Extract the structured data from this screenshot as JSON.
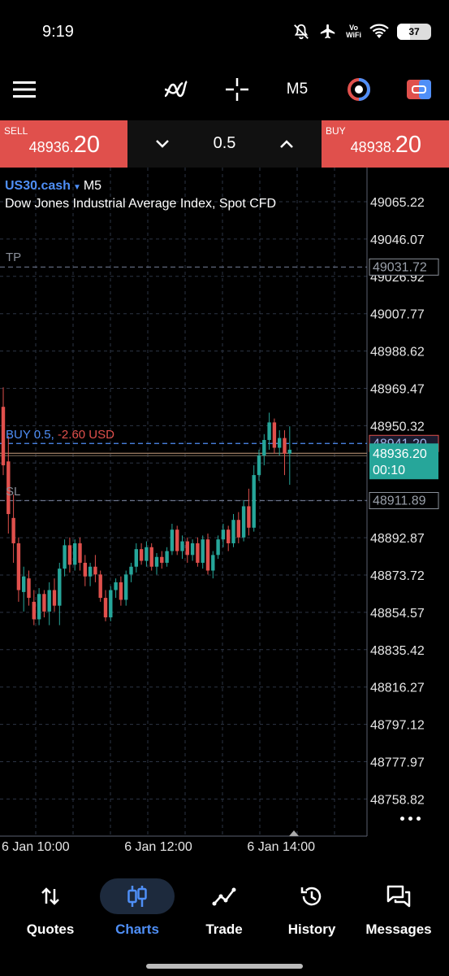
{
  "status_bar": {
    "time": "9:19",
    "network_label": "Vo\nWiFi",
    "battery": "37",
    "battery_level": 0.37
  },
  "toolbar": {
    "menu_icon": "hamburger-menu-icon",
    "indicators_icon": "indicators-icon",
    "crosshair_icon": "crosshair-icon",
    "timeframe": "M5",
    "chart_mode_icon": "chart-mode-icon",
    "trade_toggle_icon": "one-click-trade-icon"
  },
  "trade_panel": {
    "sell": {
      "label": "SELL",
      "price_main": "48936.",
      "price_big": "20"
    },
    "buy": {
      "label": "BUY",
      "price_main": "48938.",
      "price_big": "20"
    },
    "volume": "0.5"
  },
  "chart_header": {
    "symbol": "US30.cash",
    "timeframe": "M5",
    "description": "Dow Jones Industrial Average Index, Spot CFD"
  },
  "levels": {
    "tp_label": "TP",
    "tp_price": "49031.72",
    "sl_label": "SL",
    "sl_price": "48911.89",
    "position_side": "BUY 0.5,",
    "position_pl": "-2.60 USD",
    "position_price": "48941.20",
    "bid_price": "48936.20",
    "countdown": "00:10"
  },
  "colors": {
    "up": "#26a69a",
    "down": "#e0504c",
    "accent": "#4f8ff7",
    "grid": "#2c3444",
    "tp_sl_line": "#6a7289"
  },
  "chart_data": {
    "type": "candlestick",
    "symbol": "US30.cash",
    "timeframe": "M5",
    "y_ticks": [
      49065.22,
      49046.07,
      49026.92,
      49007.77,
      48988.62,
      48969.47,
      48950.32,
      48931.17,
      48912.02,
      48892.87,
      48873.72,
      48854.57,
      48835.42,
      48816.27,
      48797.12,
      48777.97,
      48758.82
    ],
    "y_tick_labels": [
      "49065.22",
      "49046.07",
      "49026.92",
      "49007.77",
      "48988.62",
      "48969.47",
      "48950.32",
      "",
      "",
      "48892.87",
      "48873.72",
      "48854.57",
      "48835.42",
      "48816.27",
      "48797.12",
      "48777.97",
      "48758.82"
    ],
    "ylim": [
      48752,
      49075
    ],
    "x_labels": [
      "6 Jan 10:00",
      "6 Jan 12:00",
      "6 Jan 14:00"
    ],
    "x_label_candle_index": [
      0,
      24,
      48
    ],
    "grid": true,
    "candles": [
      [
        48960,
        48970,
        48925,
        48930
      ],
      [
        48932,
        48945,
        48895,
        48905
      ],
      [
        48903,
        48915,
        48880,
        48890
      ],
      [
        48890,
        48893,
        48860,
        48866
      ],
      [
        48865,
        48878,
        48855,
        48873
      ],
      [
        48872,
        48876,
        48858,
        48862
      ],
      [
        48860,
        48866,
        48848,
        48851
      ],
      [
        48851,
        48867,
        48848,
        48864
      ],
      [
        48864,
        48866,
        48852,
        48855
      ],
      [
        48855,
        48870,
        48848,
        48866
      ],
      [
        48866,
        48872,
        48855,
        48858
      ],
      [
        48858,
        48880,
        48848,
        48877
      ],
      [
        48877,
        48892,
        48873,
        48889
      ],
      [
        48889,
        48893,
        48875,
        48879
      ],
      [
        48879,
        48892,
        48876,
        48890
      ],
      [
        48890,
        48893,
        48876,
        48880
      ],
      [
        48880,
        48884,
        48868,
        48873
      ],
      [
        48873,
        48880,
        48868,
        48878
      ],
      [
        48878,
        48884,
        48870,
        48874
      ],
      [
        48874,
        48876,
        48860,
        48862
      ],
      [
        48862,
        48866,
        48850,
        48852
      ],
      [
        48852,
        48868,
        48850,
        48866
      ],
      [
        48866,
        48872,
        48862,
        48870
      ],
      [
        48870,
        48873,
        48858,
        48861
      ],
      [
        48861,
        48876,
        48858,
        48874
      ],
      [
        48874,
        48880,
        48870,
        48878
      ],
      [
        48878,
        48890,
        48875,
        48887
      ],
      [
        48887,
        48890,
        48879,
        48881
      ],
      [
        48881,
        48891,
        48878,
        48888
      ],
      [
        48888,
        48890,
        48876,
        48878
      ],
      [
        48878,
        48885,
        48874,
        48883
      ],
      [
        48883,
        48886,
        48877,
        48880
      ],
      [
        48880,
        48888,
        48878,
        48886
      ],
      [
        48886,
        48900,
        48884,
        48897
      ],
      [
        48897,
        48899,
        48884,
        48886
      ],
      [
        48886,
        48894,
        48882,
        48891
      ],
      [
        48891,
        48893,
        48880,
        48884
      ],
      [
        48884,
        48892,
        48881,
        48890
      ],
      [
        48890,
        48893,
        48878,
        48880
      ],
      [
        48880,
        48894,
        48877,
        48892
      ],
      [
        48892,
        48895,
        48874,
        48876
      ],
      [
        48876,
        48886,
        48872,
        48884
      ],
      [
        48884,
        48894,
        48882,
        48892
      ],
      [
        48892,
        48900,
        48888,
        48897
      ],
      [
        48897,
        48899,
        48886,
        48890
      ],
      [
        48890,
        48905,
        48888,
        48902
      ],
      [
        48902,
        48906,
        48890,
        48893
      ],
      [
        48893,
        48912,
        48891,
        48909
      ],
      [
        48909,
        48918,
        48894,
        48898
      ],
      [
        48898,
        48930,
        48896,
        48925
      ],
      [
        48925,
        48938,
        48922,
        48935
      ],
      [
        48935,
        48946,
        48930,
        48943
      ],
      [
        48943,
        48957,
        48938,
        48952
      ],
      [
        48952,
        48954,
        48936,
        48939
      ],
      [
        48939,
        48948,
        48935,
        48944
      ],
      [
        48944,
        48948,
        48925,
        48936
      ],
      [
        48936,
        48950,
        48920,
        48938
      ]
    ]
  },
  "bottom_nav": [
    {
      "label": "Quotes",
      "icon": "quotes-arrows-icon",
      "active": false
    },
    {
      "label": "Charts",
      "icon": "candlestick-chart-icon",
      "active": true
    },
    {
      "label": "Trade",
      "icon": "trade-line-icon",
      "active": false
    },
    {
      "label": "History",
      "icon": "history-clock-icon",
      "active": false
    },
    {
      "label": "Messages",
      "icon": "messages-chat-icon",
      "active": false
    }
  ]
}
